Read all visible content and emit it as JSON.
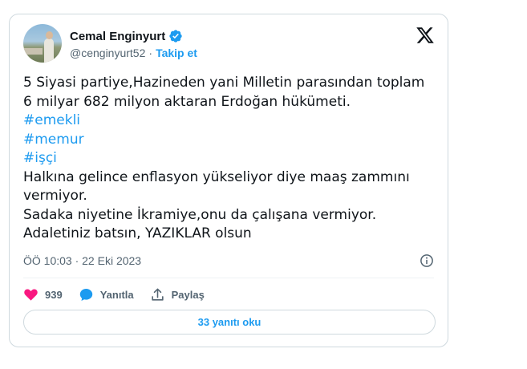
{
  "author": {
    "name": "Cemal Enginyurt",
    "handle": "@cenginyurt52",
    "separator": "·",
    "follow_label": "Takip et"
  },
  "tweet": {
    "lines": [
      "5 Siyasi partiye,Hazineden yani Milletin parasından toplam",
      "6 milyar 682 milyon aktaran Erdoğan hükümeti.",
      "#emekli",
      "#memur",
      "#işçi",
      "Halkına gelince enflasyon yükseliyor diye maaş zammını",
      "vermiyor.",
      "Sadaka niyetine İkramiye,onu da çalışana vermiyor.",
      "Adaletiniz batsın, YAZIKLAR olsun"
    ]
  },
  "meta": {
    "timestamp": "ÖÖ 10:03 · 22 Eki 2023"
  },
  "actions": {
    "like_count": "939",
    "reply_label": "Yanıtla",
    "share_label": "Paylaş"
  },
  "replies_button": "33 yanıtı oku",
  "colors": {
    "accent": "#1d9bf0",
    "like": "#f91880",
    "text": "#0f1419",
    "muted": "#536471",
    "border": "#cfd9de"
  },
  "icons": {
    "verified": "verified-badge-icon",
    "brand": "x-logo-icon",
    "info": "info-icon",
    "like": "heart-icon",
    "reply": "speech-bubble-icon",
    "share": "share-icon"
  }
}
